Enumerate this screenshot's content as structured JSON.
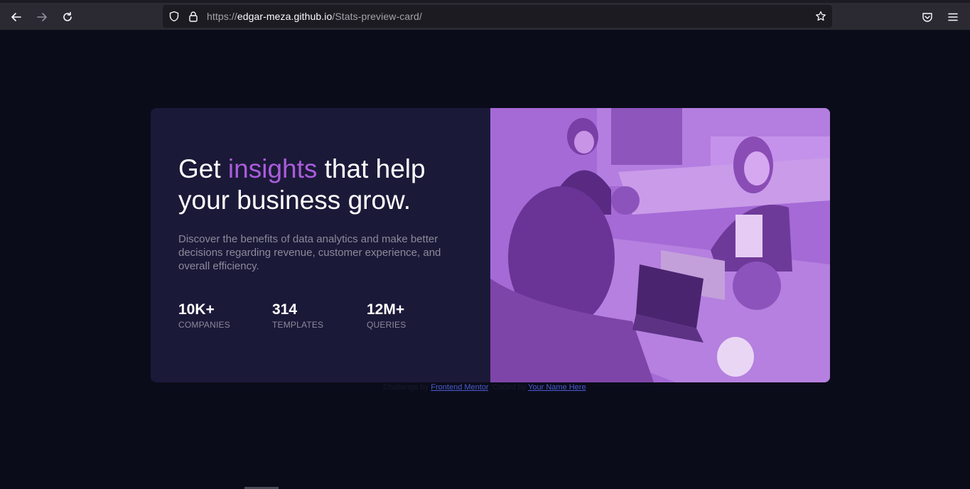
{
  "browser": {
    "url_prefix": "https://",
    "url_host": "edgar-meza.github.io",
    "url_path": "/Stats-preview-card/"
  },
  "card": {
    "headline_before": "Get ",
    "headline_accent": "insights",
    "headline_after": " that help your business grow.",
    "description": "Discover the benefits of data analytics and make better decisions regarding revenue, customer experience, and overall efficiency.",
    "stats": [
      {
        "value": "10K+",
        "label": "COMPANIES"
      },
      {
        "value": "314",
        "label": "TEMPLATES"
      },
      {
        "value": "12M+",
        "label": "QUERIES"
      }
    ],
    "accent_color": "#aa5cdb",
    "image_overlay_color": "#a568d6"
  },
  "attribution": {
    "prefix": "Challenge by ",
    "link1": "Frontend Mentor",
    "middle": ". Coded by ",
    "link2": "Your Name Here",
    "suffix": "."
  }
}
